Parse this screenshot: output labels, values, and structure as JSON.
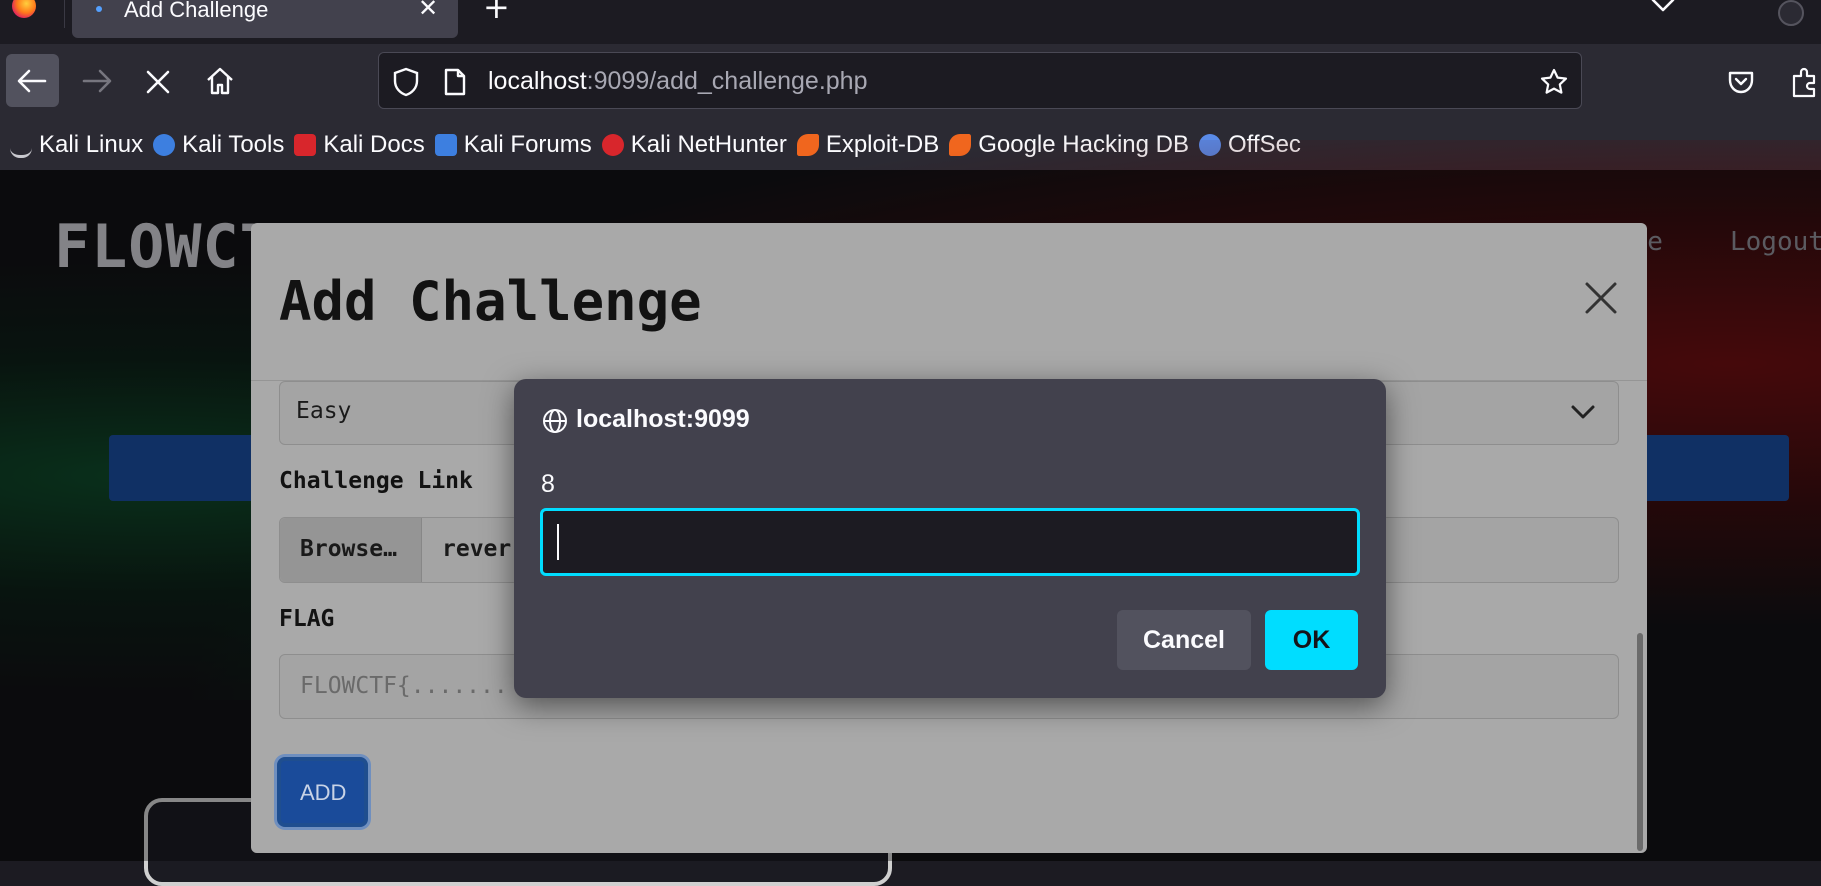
{
  "browser": {
    "tab": {
      "title": "Add Challenge",
      "close_glyph": "✕"
    },
    "new_tab_glyph": "+",
    "url": {
      "host": "localhost",
      "rest": ":9099/add_challenge.php"
    },
    "bookmarks": [
      {
        "label": "Kali Linux",
        "icon": "kali-dragon-icon",
        "color": "#c9c9cf"
      },
      {
        "label": "Kali Tools",
        "icon": "kali-tools-icon",
        "color": "#3d7fe0"
      },
      {
        "label": "Kali Docs",
        "icon": "kali-docs-icon",
        "color": "#d8262c"
      },
      {
        "label": "Kali Forums",
        "icon": "kali-forums-icon",
        "color": "#3d7fe0"
      },
      {
        "label": "Kali NetHunter",
        "icon": "kali-nethunter-icon",
        "color": "#d8262c"
      },
      {
        "label": "Exploit-DB",
        "icon": "exploit-db-icon",
        "color": "#f0661e"
      },
      {
        "label": "Google Hacking DB",
        "icon": "ghdb-icon",
        "color": "#f0661e"
      },
      {
        "label": "OffSec",
        "icon": "offsec-icon",
        "color": "#5a8be8"
      }
    ]
  },
  "site": {
    "logo": "FLOWCTF",
    "nav": {
      "challenge": "nge",
      "logout": "Logout"
    }
  },
  "modal": {
    "title": "Add Challenge",
    "difficulty_value": "Easy",
    "challenge_link_label": "Challenge Link",
    "browse_label": "Browse…",
    "file_name": "rever",
    "flag_label": "FLAG",
    "flag_placeholder": "FLOWCTF{.......",
    "add_label": "ADD"
  },
  "prompt": {
    "origin": "localhost:9099",
    "message": "8",
    "input_value": "",
    "cancel_label": "Cancel",
    "ok_label": "OK"
  },
  "colors": {
    "accent": "#00ddff",
    "site_blue": "#1a4b9a"
  }
}
